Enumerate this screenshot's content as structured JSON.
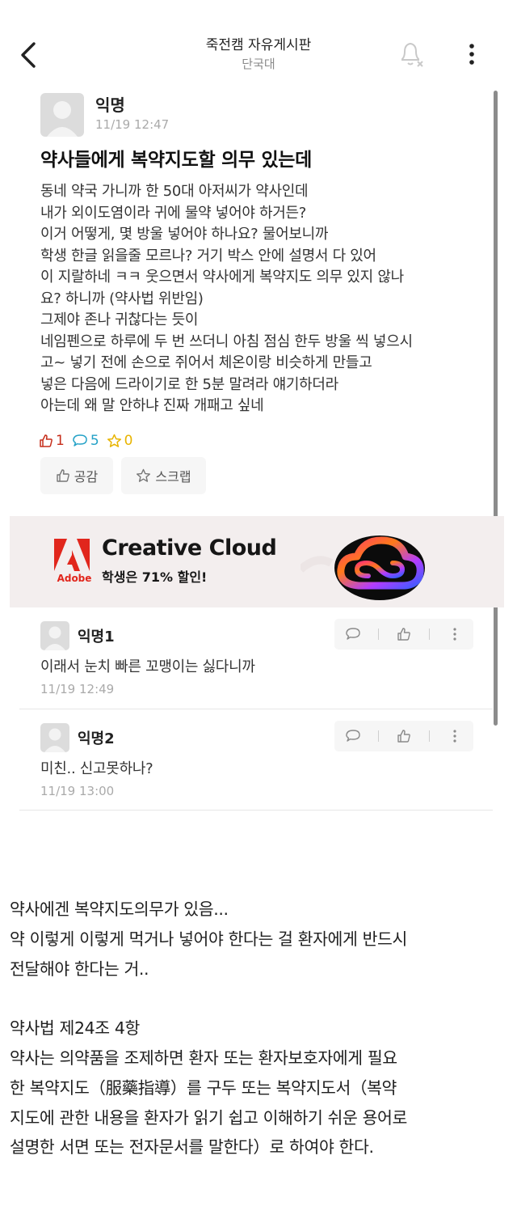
{
  "header": {
    "board_title": "죽전캠 자유게시판",
    "school_name": "단국대"
  },
  "post": {
    "author": "익명",
    "date": "11/19 12:47",
    "title": "약사들에게 복약지도할 의무 있는데",
    "body_lines": [
      "동네 약국 가니까 한 50대 아저씨가 약사인데",
      "내가 외이도염이라 귀에 물약 넣어야 하거든?",
      "이거 어떻게, 몇 방울 넣어야 하나요? 물어보니까",
      "학생 한글 읽을줄 모르나? 거기 박스 안에 설명서 다 있어",
      "이 지랄하네 ㅋㅋ 웃으면서 약사에게 복약지도 의무 있지 않나",
      "요? 하니까 (약사법 위반임)",
      "그제야 존나 귀찮다는 듯이",
      "네임펜으로 하루에 두 번 쓰더니 아침 점심 한두 방울 씩 넣으시",
      "고~ 넣기 전에 손으로 쥐어서 체온이랑 비슷하게 만들고",
      "넣은 다음에 드라이기로 한 5분 말려라 얘기하더라",
      "아는데 왜 말 안하냐 진짜 개패고 싶네"
    ],
    "likes": "1",
    "comments": "5",
    "scraps": "0",
    "empathy_label": "공감",
    "scrap_label": "스크랩"
  },
  "ad": {
    "brand": "Adobe",
    "title": "Creative Cloud",
    "subtitle": "학생은 71% 할인!"
  },
  "comments": [
    {
      "author": "익명1",
      "text": "이래서 눈치 빠른 꼬맹이는 싫다니까",
      "date": "11/19 12:49"
    },
    {
      "author": "익명2",
      "text": "미친.. 신고못하나?",
      "date": "11/19 13:00"
    }
  ],
  "caption_lines": [
    "약사에겐 복약지도의무가 있음...",
    "약 이렇게 이렇게 먹거나 넣어야 한다는 걸 환자에게 반드시",
    "전달해야 한다는 거..",
    "",
    "약사법 제24조 4항",
    "약사는 의약품을 조제하면 환자 또는 환자보호자에게 필요",
    "한 복약지도（服藥指導）를 구두 또는 복약지도서（복약",
    "지도에 관한 내용을 환자가 읽기 쉽고 이해하기 쉬운 용어로",
    "설명한 서면 또는 전자문서를 말한다）로 하여야 한다."
  ],
  "colors": {
    "like": "#c62d1a",
    "comment": "#25a2c7",
    "scrap": "#e8b400",
    "adobe_red": "#e1261c"
  }
}
